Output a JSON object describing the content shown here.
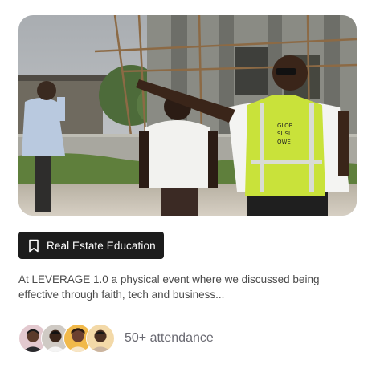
{
  "card": {
    "image_alt": "Real estate site visit photo",
    "tag_icon": "bookmark-icon",
    "tag_label": "Real Estate Education",
    "description": "At LEVERAGE 1.0 a physical event where we discussed being effective through faith, tech and business...",
    "attendance_label": "50+ attendance",
    "attendee_avatars": [
      "avatar-1",
      "avatar-2",
      "avatar-3",
      "avatar-4"
    ]
  },
  "vest_text": "GLOB SUSI OWE",
  "colors": {
    "tag_bg": "#1c1c1c",
    "tag_text": "#ffffff",
    "description_text": "#4a4a4a",
    "attendance_text": "#6a6a72",
    "vest": "#c9e23a"
  }
}
